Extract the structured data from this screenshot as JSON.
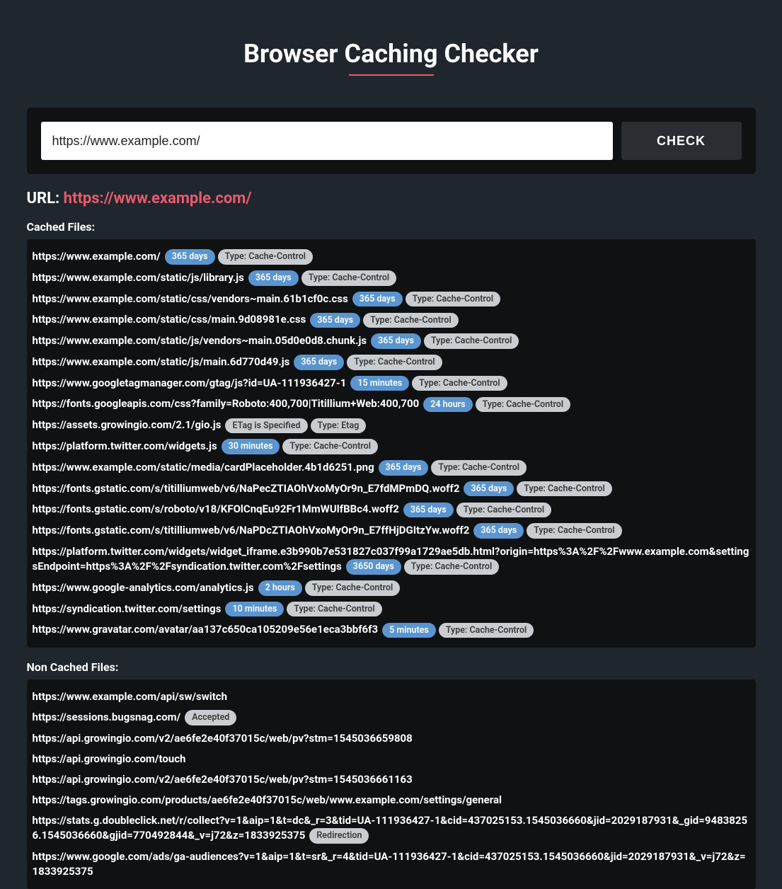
{
  "title": "Browser Caching Checker",
  "search": {
    "value": "https://www.example.com/",
    "button": "CHECK"
  },
  "result_url_label": "URL: ",
  "result_url": "https://www.example.com/",
  "cached_label": "Cached Files:",
  "noncached_label": "Non Cached Files:",
  "cached": [
    {
      "url": "https://www.example.com/",
      "duration": "365 days",
      "type": "Type: Cache-Control"
    },
    {
      "url": "https://www.example.com/static/js/library.js",
      "duration": "365 days",
      "type": "Type: Cache-Control"
    },
    {
      "url": "https://www.example.com/static/css/vendors~main.61b1cf0c.css",
      "duration": "365 days",
      "type": "Type: Cache-Control"
    },
    {
      "url": "https://www.example.com/static/css/main.9d08981e.css",
      "duration": "365 days",
      "type": "Type: Cache-Control"
    },
    {
      "url": "https://www.example.com/static/js/vendors~main.05d0e0d8.chunk.js",
      "duration": "365 days",
      "type": "Type: Cache-Control"
    },
    {
      "url": "https://www.example.com/static/js/main.6d770d49.js",
      "duration": "365 days",
      "type": "Type: Cache-Control"
    },
    {
      "url": "https://www.googletagmanager.com/gtag/js?id=UA-111936427-1",
      "duration": "15 minutes",
      "type": "Type: Cache-Control"
    },
    {
      "url": "https://fonts.googleapis.com/css?family=Roboto:400,700|Titillium+Web:400,700",
      "duration": "24 hours",
      "type": "Type: Cache-Control"
    },
    {
      "url": "https://assets.growingio.com/2.1/gio.js",
      "duration_gray": "ETag is Specified",
      "type": "Type: Etag"
    },
    {
      "url": "https://platform.twitter.com/widgets.js",
      "duration": "30 minutes",
      "type": "Type: Cache-Control"
    },
    {
      "url": "https://www.example.com/static/media/cardPlaceholder.4b1d6251.png",
      "duration": "365 days",
      "type": "Type: Cache-Control"
    },
    {
      "url": "https://fonts.gstatic.com/s/titilliumweb/v6/NaPecZTIAOhVxoMyOr9n_E7fdMPmDQ.woff2",
      "duration": "365 days",
      "type": "Type: Cache-Control"
    },
    {
      "url": "https://fonts.gstatic.com/s/roboto/v18/KFOlCnqEu92Fr1MmWUlfBBc4.woff2",
      "duration": "365 days",
      "type": "Type: Cache-Control"
    },
    {
      "url": "https://fonts.gstatic.com/s/titilliumweb/v6/NaPDcZTIAOhVxoMyOr9n_E7ffHjDGItzYw.woff2",
      "duration": "365 days",
      "type": "Type: Cache-Control"
    },
    {
      "url": "https://platform.twitter.com/widgets/widget_iframe.e3b990b7e531827c037f99a1729ae5db.html?origin=https%3A%2F%2Fwww.example.com&settingsEndpoint=https%3A%2F%2Fsyndication.twitter.com%2Fsettings",
      "duration": "3650 days",
      "type": "Type: Cache-Control"
    },
    {
      "url": "https://www.google-analytics.com/analytics.js",
      "duration": "2 hours",
      "type": "Type: Cache-Control"
    },
    {
      "url": "https://syndication.twitter.com/settings",
      "duration": "10 minutes",
      "type": "Type: Cache-Control"
    },
    {
      "url": "https://www.gravatar.com/avatar/aa137c650ca105209e56e1eca3bbf6f3",
      "duration": "5 minutes",
      "type": "Type: Cache-Control"
    }
  ],
  "noncached": [
    {
      "url": "https://www.example.com/api/sw/switch"
    },
    {
      "url": "https://sessions.bugsnag.com/",
      "tag": "Accepted"
    },
    {
      "url": "https://api.growingio.com/v2/ae6fe2e40f37015c/web/pv?stm=1545036659808"
    },
    {
      "url": "https://api.growingio.com/touch"
    },
    {
      "url": "https://api.growingio.com/v2/ae6fe2e40f37015c/web/pv?stm=1545036661163"
    },
    {
      "url": "https://tags.growingio.com/products/ae6fe2e40f37015c/web/www.example.com/settings/general"
    },
    {
      "url": "https://stats.g.doubleclick.net/r/collect?v=1&aip=1&t=dc&_r=3&tid=UA-111936427-1&cid=437025153.1545036660&jid=2029187931&_gid=94838256.1545036660&gjid=770492844&_v=j72&z=1833925375",
      "tag": "Redirection"
    },
    {
      "url": "https://www.google.com/ads/ga-audiences?v=1&aip=1&t=sr&_r=4&tid=UA-111936427-1&cid=437025153.1545036660&jid=2029187931&_v=j72&z=1833925375"
    }
  ]
}
